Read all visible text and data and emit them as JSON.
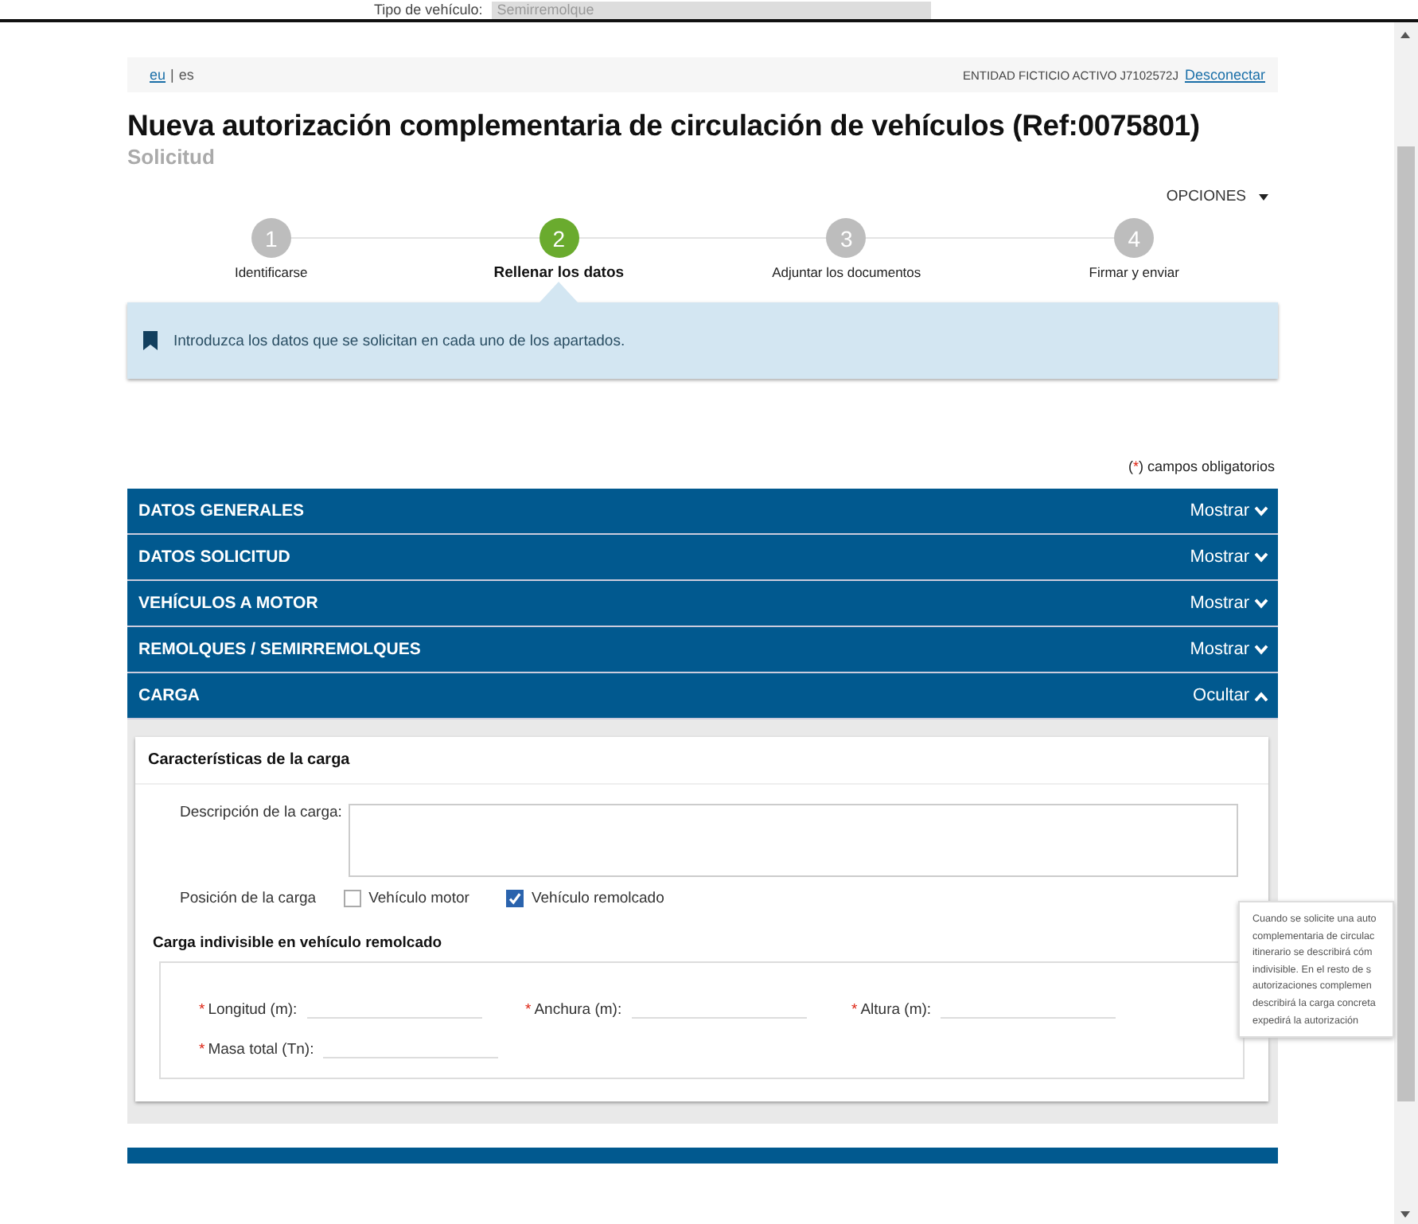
{
  "background_window": {
    "label": "Tipo de vehículo:",
    "value": "Semirremolque"
  },
  "topbar": {
    "languages": [
      {
        "label": "eu",
        "selected": false
      },
      {
        "label": "es",
        "selected": true
      }
    ],
    "separator": "|",
    "user": "ENTIDAD FICTICIO ACTIVO J7102572J",
    "logout": "Desconectar"
  },
  "title": "Nueva autorización complementaria de circulación de vehículos (Ref:0075801)",
  "subtitle": "Solicitud",
  "options": "OPCIONES",
  "steps": [
    {
      "number": "1",
      "label": "Identificarse",
      "selected": false
    },
    {
      "number": "2",
      "label": "Rellenar los datos",
      "selected": true
    },
    {
      "number": "3",
      "label": "Adjuntar los documentos",
      "selected": false
    },
    {
      "number": "4",
      "label": "Firmar y enviar",
      "selected": false
    }
  ],
  "info": "Introduzca los datos que se solicitan en cada uno de los apartados.",
  "required_note": {
    "open": "(",
    "mark": "*",
    "rest": ") campos obligatorios"
  },
  "sections": [
    {
      "title": "DATOS GENERALES",
      "toggle": "Mostrar",
      "expanded": false
    },
    {
      "title": "DATOS SOLICITUD",
      "toggle": "Mostrar",
      "expanded": false
    },
    {
      "title": "VEHÍCULOS A MOTOR",
      "toggle": "Mostrar",
      "expanded": false
    },
    {
      "title": "REMOLQUES / SEMIRREMOLQUES",
      "toggle": "Mostrar",
      "expanded": false
    },
    {
      "title": "CARGA",
      "toggle": "Ocultar",
      "expanded": true
    }
  ],
  "cargo_panel": {
    "title": "Características de la carga",
    "description_label": "Descripción de la carga:",
    "position_label": "Posición de la carga",
    "position_options": [
      {
        "label": "Vehículo motor",
        "checked": false
      },
      {
        "label": "Vehículo remolcado",
        "checked": true
      }
    ],
    "subsection": "Carga indivisible en vehículo remolcado",
    "required_mark": "*",
    "fields": [
      {
        "label": "Longitud (m):",
        "required": true
      },
      {
        "label": "Anchura (m):",
        "required": true
      },
      {
        "label": "Altura (m):",
        "required": true
      },
      {
        "label": "Masa total (Tn):",
        "required": true
      }
    ]
  },
  "tooltip": {
    "lines": [
      "Cuando se solicite una auto",
      "complementaria de circulac",
      "itinerario se describirá cóm",
      "indivisible. En el resto de s",
      "autorizaciones complemen",
      "describirá la carga concreta",
      "expedirá la autorización"
    ]
  }
}
